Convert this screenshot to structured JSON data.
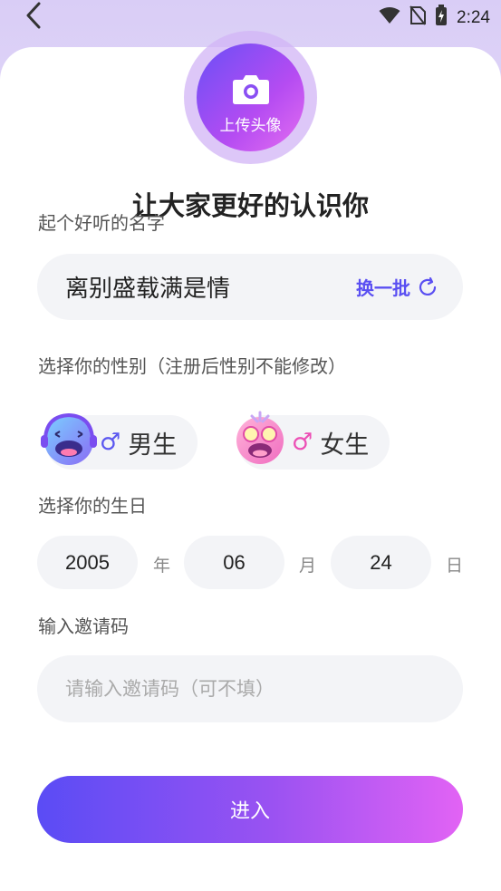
{
  "status_bar": {
    "time": "2:24"
  },
  "avatar": {
    "label": "上传头像"
  },
  "headline": "让大家更好的认识你",
  "name_section": {
    "label": "起个好听的名字",
    "value": "离别盛载满是情",
    "refresh_label": "换一批"
  },
  "gender_section": {
    "label": "选择你的性别（注册后性别不能修改）",
    "options": [
      {
        "symbol": "♂",
        "label": "男生",
        "color": "#5b57f0"
      },
      {
        "symbol": "♂",
        "label": "女生",
        "color": "#ec4fb5"
      }
    ]
  },
  "birthday_section": {
    "label": "选择你的生日",
    "year": "2005",
    "year_unit": "年",
    "month": "06",
    "month_unit": "月",
    "day": "24",
    "day_unit": "日"
  },
  "invite_section": {
    "label": "输入邀请码",
    "placeholder": "请输入邀请码（可不填）"
  },
  "submit_label": "进入",
  "colors": {
    "accent": "#5a4ff2",
    "gradient_start": "#5a4cf5",
    "gradient_end": "#e263f4",
    "field_bg": "#f3f4f7"
  }
}
